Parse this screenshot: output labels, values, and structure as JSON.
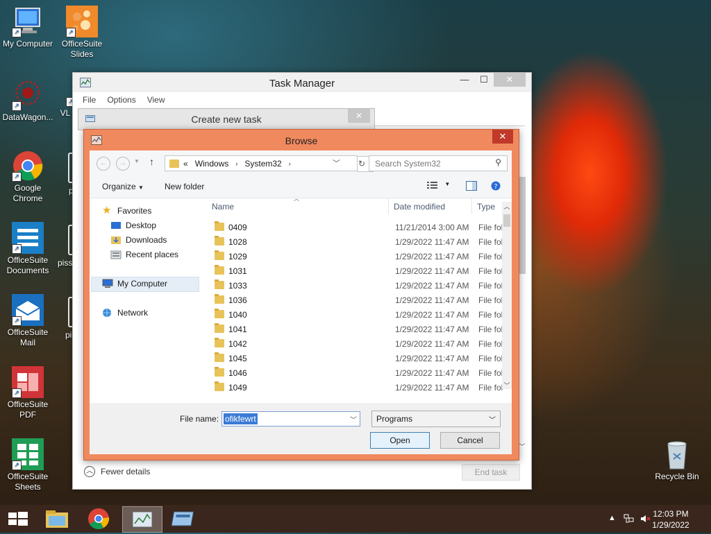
{
  "desktop": {
    "icons": [
      {
        "label": "My Computer"
      },
      {
        "label": "OfficeSuite Slides"
      },
      {
        "label": "DataWagon..."
      },
      {
        "label": "VL"
      },
      {
        "label": "Google Chrome"
      },
      {
        "label": "OfficeSuite Documents"
      },
      {
        "label": "OfficeSuite Mail"
      },
      {
        "label": "OfficeSuite PDF"
      },
      {
        "label": "OfficeSuite Sheets"
      },
      {
        "label": "Recycle Bin"
      }
    ],
    "partial_labels": [
      "p",
      "piss",
      "pi"
    ]
  },
  "task_manager": {
    "title": "Task Manager",
    "menu": [
      "File",
      "Options",
      "View"
    ],
    "fewer_details": "Fewer details",
    "end_task": "End task",
    "colors": {
      "title_bg": "#f0f0f0"
    }
  },
  "create_new_task": {
    "title": "Create new task"
  },
  "browse": {
    "title": "Browse",
    "address": {
      "prefix": "«",
      "path": [
        "Windows",
        "System32"
      ]
    },
    "search_placeholder": "Search System32",
    "toolbar": {
      "organize": "Organize",
      "new_folder": "New folder"
    },
    "nav": {
      "favorites": "Favorites",
      "desktop": "Desktop",
      "downloads": "Downloads",
      "recent": "Recent places",
      "my_computer": "My Computer",
      "network": "Network"
    },
    "columns": {
      "name": "Name",
      "date": "Date modified",
      "type": "Type"
    },
    "files": [
      {
        "name": "0409",
        "date": "11/21/2014 3:00 AM",
        "type": "File fol"
      },
      {
        "name": "1028",
        "date": "1/29/2022 11:47 AM",
        "type": "File fol"
      },
      {
        "name": "1029",
        "date": "1/29/2022 11:47 AM",
        "type": "File fol"
      },
      {
        "name": "1031",
        "date": "1/29/2022 11:47 AM",
        "type": "File fol"
      },
      {
        "name": "1033",
        "date": "1/29/2022 11:47 AM",
        "type": "File fol"
      },
      {
        "name": "1036",
        "date": "1/29/2022 11:47 AM",
        "type": "File fol"
      },
      {
        "name": "1040",
        "date": "1/29/2022 11:47 AM",
        "type": "File fol"
      },
      {
        "name": "1041",
        "date": "1/29/2022 11:47 AM",
        "type": "File fol"
      },
      {
        "name": "1042",
        "date": "1/29/2022 11:47 AM",
        "type": "File fol"
      },
      {
        "name": "1045",
        "date": "1/29/2022 11:47 AM",
        "type": "File fol"
      },
      {
        "name": "1046",
        "date": "1/29/2022 11:47 AM",
        "type": "File fol"
      },
      {
        "name": "1049",
        "date": "1/29/2022 11:47 AM",
        "type": "File fol"
      }
    ],
    "file_name_label": "File name:",
    "file_name_value": "ofikfewrt",
    "file_type_value": "Programs",
    "open": "Open",
    "cancel": "Cancel",
    "colors": {
      "frame": "#f08a5e",
      "close": "#c0392b"
    }
  },
  "taskbar": {
    "time": "12:03 PM",
    "date": "1/29/2022"
  }
}
